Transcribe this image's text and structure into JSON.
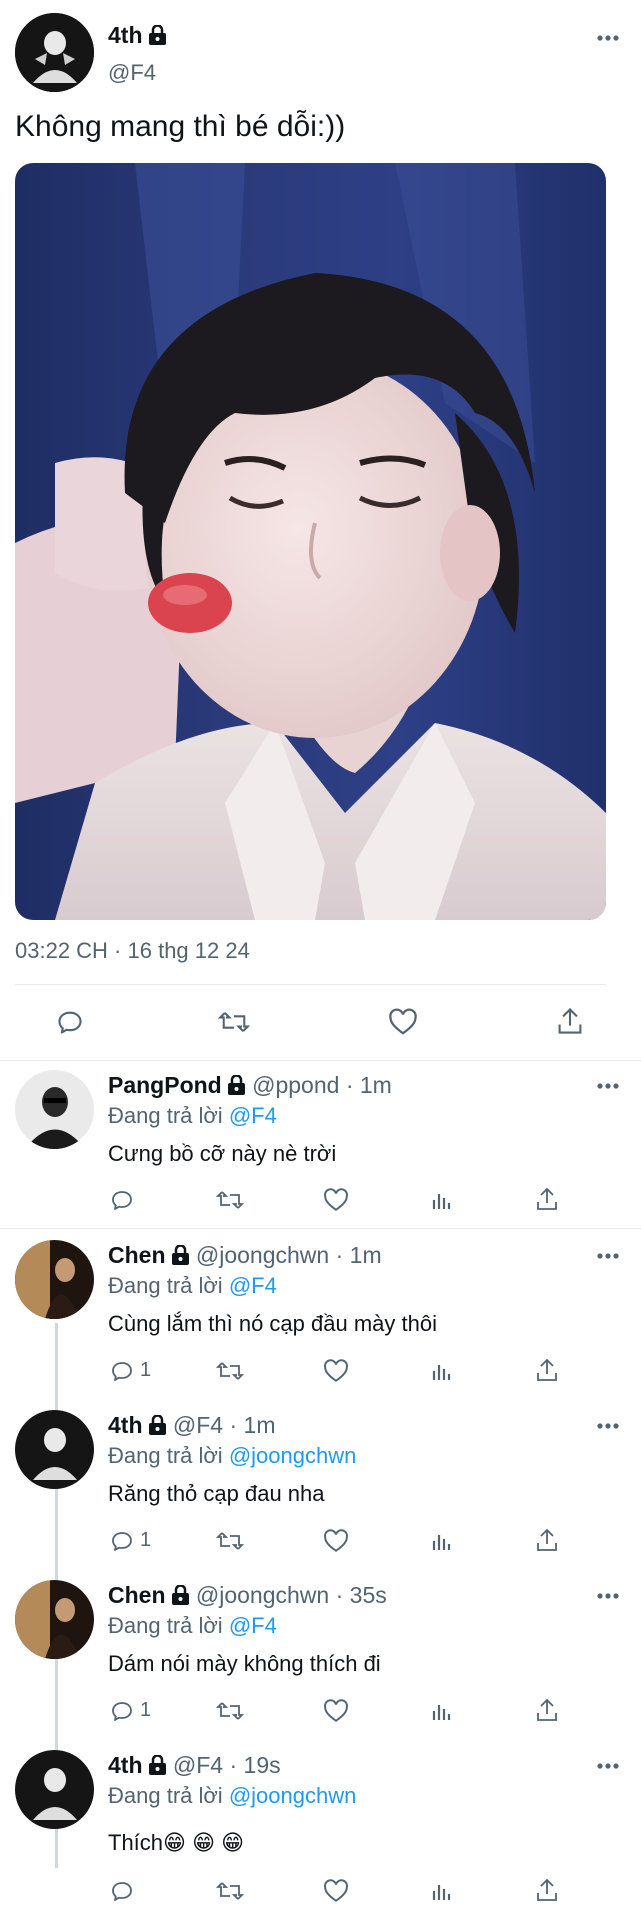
{
  "main_tweet": {
    "display_name": "4th",
    "handle": "@F4",
    "text": "Không mang thì bé dỗi:))",
    "timestamp": "03:22 CH · 16 thg 12 24",
    "image_alt": "photo"
  },
  "replying_label": "Đang trả lời",
  "replies": [
    {
      "display_name": "PangPond",
      "handle": "@ppond",
      "time": "· 1m",
      "replying_to": "@F4",
      "text": "Cưng bồ cỡ này nè trời",
      "reply_count": ""
    },
    {
      "display_name": "Chen",
      "handle": "@joongchwn",
      "time": "· 1m",
      "replying_to": "@F4",
      "text": "Cùng lắm thì nó cạp đầu mày thôi",
      "reply_count": "1"
    },
    {
      "display_name": "4th",
      "handle": "@F4",
      "time": "· 1m",
      "replying_to": "@joongchwn",
      "text": "Răng thỏ cạp đau nha",
      "reply_count": "1"
    },
    {
      "display_name": "Chen",
      "handle": "@joongchwn",
      "time": "· 35s",
      "replying_to": "@F4",
      "text": "Dám nói mày không thích đi",
      "reply_count": "1"
    },
    {
      "display_name": "4th",
      "handle": "@F4",
      "time": "· 19s",
      "replying_to": "@joongchwn",
      "text": "Thích😁 😁 😁",
      "reply_count": ""
    }
  ],
  "colors": {
    "link": "#1d9bf0",
    "muted": "#536471",
    "divider": "#e7e9ea"
  }
}
